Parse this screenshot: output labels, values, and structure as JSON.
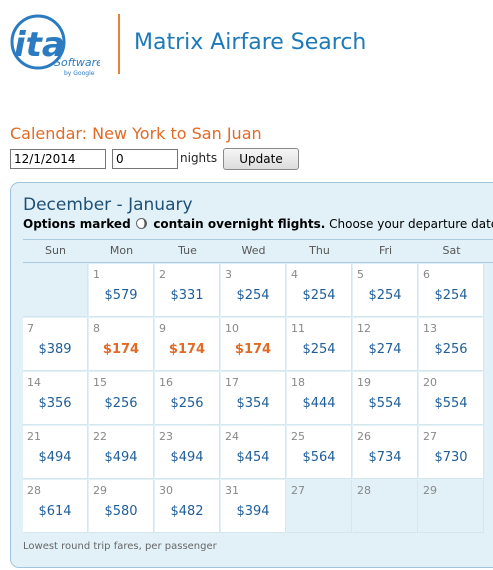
{
  "header": {
    "logo_text": "ita",
    "logo_software": "Software",
    "logo_byline": "by Google",
    "title": "Matrix Airfare Search"
  },
  "search": {
    "heading": "Calendar: New York to San Juan",
    "date_value": "12/1/2014",
    "nights_value": "0",
    "nights_label": "nights",
    "update_label": "Update"
  },
  "calendar": {
    "title": "December - January",
    "note_bold_prefix": "Options marked",
    "note_bold_suffix": "contain overnight flights.",
    "note_rest": "Choose your departure date",
    "overnight_icon": "moon-icon",
    "days_of_week": [
      "Sun",
      "Mon",
      "Tue",
      "Wed",
      "Thu",
      "Fri",
      "Sat"
    ],
    "weeks": [
      [
        {
          "day": "",
          "price": "",
          "empty": true
        },
        {
          "day": "1",
          "price": "$579"
        },
        {
          "day": "2",
          "price": "$331"
        },
        {
          "day": "3",
          "price": "$254"
        },
        {
          "day": "4",
          "price": "$254"
        },
        {
          "day": "5",
          "price": "$254"
        },
        {
          "day": "6",
          "price": "$254"
        }
      ],
      [
        {
          "day": "7",
          "price": "$389"
        },
        {
          "day": "8",
          "price": "$174",
          "lowest": true
        },
        {
          "day": "9",
          "price": "$174",
          "lowest": true
        },
        {
          "day": "10",
          "price": "$174",
          "lowest": true
        },
        {
          "day": "11",
          "price": "$254"
        },
        {
          "day": "12",
          "price": "$274"
        },
        {
          "day": "13",
          "price": "$256"
        }
      ],
      [
        {
          "day": "14",
          "price": "$356"
        },
        {
          "day": "15",
          "price": "$256"
        },
        {
          "day": "16",
          "price": "$256"
        },
        {
          "day": "17",
          "price": "$354"
        },
        {
          "day": "18",
          "price": "$444"
        },
        {
          "day": "19",
          "price": "$554"
        },
        {
          "day": "20",
          "price": "$554"
        }
      ],
      [
        {
          "day": "21",
          "price": "$494"
        },
        {
          "day": "22",
          "price": "$494"
        },
        {
          "day": "23",
          "price": "$494"
        },
        {
          "day": "24",
          "price": "$454"
        },
        {
          "day": "25",
          "price": "$564"
        },
        {
          "day": "26",
          "price": "$734"
        },
        {
          "day": "27",
          "price": "$730"
        }
      ],
      [
        {
          "day": "28",
          "price": "$614"
        },
        {
          "day": "29",
          "price": "$580"
        },
        {
          "day": "30",
          "price": "$482"
        },
        {
          "day": "31",
          "price": "$394"
        },
        {
          "day": "27",
          "price": "",
          "out_of_range": true
        },
        {
          "day": "28",
          "price": "",
          "out_of_range": true
        },
        {
          "day": "29",
          "price": "",
          "out_of_range": true
        }
      ]
    ],
    "footer": "Lowest round trip fares, per passenger"
  },
  "colors": {
    "accent_orange": "#e06a26",
    "brand_blue": "#1d7ab8",
    "price_blue": "#1f5e98",
    "panel_bg": "#e2f1f8"
  }
}
